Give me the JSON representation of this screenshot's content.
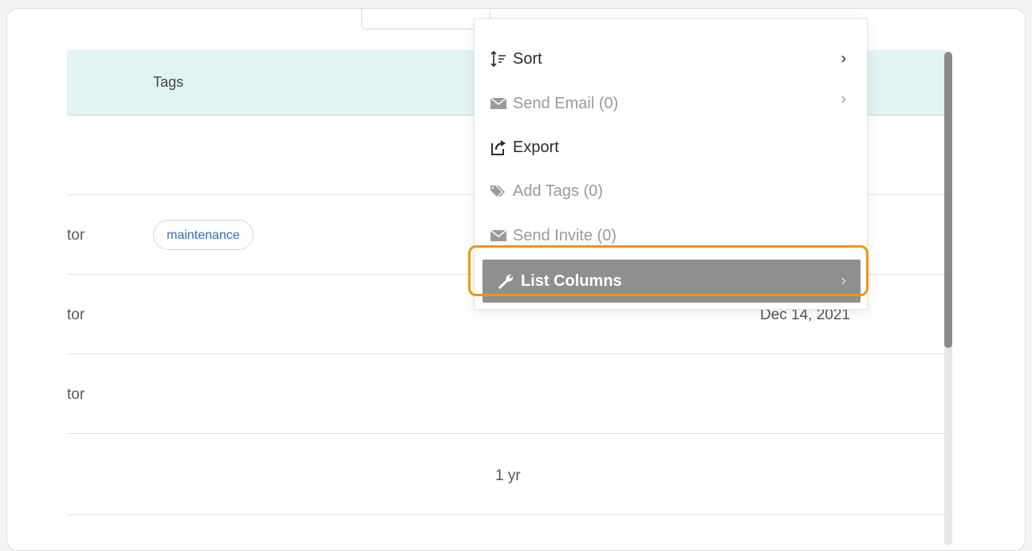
{
  "table": {
    "header": {
      "tags_label": "Tags"
    },
    "rows": [
      {
        "role": "",
        "tag": "",
        "date": "",
        "age": ""
      },
      {
        "role": "tor",
        "tag": "maintenance",
        "date": "",
        "age": ""
      },
      {
        "role": "tor",
        "tag": "",
        "date": "Dec 14, 2021",
        "age": ""
      },
      {
        "role": "tor",
        "tag": "",
        "date": "",
        "age": ""
      },
      {
        "role": "",
        "tag": "",
        "date": "",
        "age": "1 yr"
      }
    ]
  },
  "menu": {
    "items": [
      {
        "label": "Sort",
        "icon": "sort-icon",
        "enabled": true,
        "submenu": true
      },
      {
        "label": "Send Email (0)",
        "icon": "envelope-icon",
        "enabled": false,
        "submenu": true
      },
      {
        "label": "Export",
        "icon": "export-icon",
        "enabled": true,
        "submenu": false
      },
      {
        "label": "Add Tags (0)",
        "icon": "tags-icon",
        "enabled": false,
        "submenu": false
      },
      {
        "label": "Send Invite (0)",
        "icon": "envelope-icon",
        "enabled": false,
        "submenu": false
      },
      {
        "label": "List Columns",
        "icon": "wrench-icon",
        "enabled": true,
        "submenu": true,
        "active": true
      }
    ],
    "chevron": "›"
  },
  "colors": {
    "header_bg": "#e2f3f3",
    "highlight": "#f0960c",
    "active_bg": "#8f8f8f",
    "tag_text": "#2f6fbf"
  }
}
